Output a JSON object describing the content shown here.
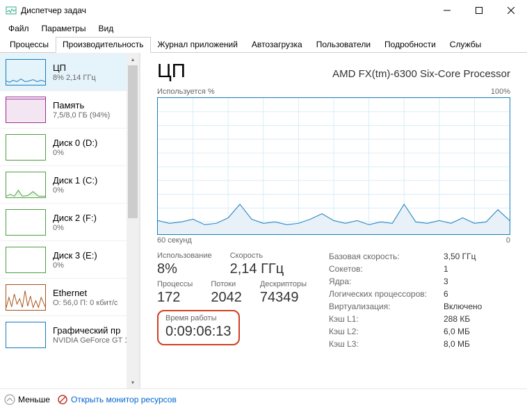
{
  "window": {
    "title": "Диспетчер задач"
  },
  "menu": {
    "file": "Файл",
    "options": "Параметры",
    "view": "Вид"
  },
  "tabs": {
    "processes": "Процессы",
    "performance": "Производительность",
    "app_history": "Журнал приложений",
    "startup": "Автозагрузка",
    "users": "Пользователи",
    "details": "Подробности",
    "services": "Службы"
  },
  "sidebar": {
    "cpu": {
      "title": "ЦП",
      "sub": "8% 2,14 ГГц"
    },
    "memory": {
      "title": "Память",
      "sub": "7,5/8,0 ГБ (94%)"
    },
    "disk0": {
      "title": "Диск 0 (D:)",
      "sub": "0%"
    },
    "disk1": {
      "title": "Диск 1 (C:)",
      "sub": "0%"
    },
    "disk2": {
      "title": "Диск 2 (F:)",
      "sub": "0%"
    },
    "disk3": {
      "title": "Диск 3 (E:)",
      "sub": "0%"
    },
    "ethernet": {
      "title": "Ethernet",
      "sub": "О: 56,0 П: 0 кбит/с"
    },
    "gpu": {
      "title": "Графический пр",
      "sub": "NVIDIA GeForce GT 1"
    }
  },
  "cpu": {
    "title": "ЦП",
    "model": "AMD FX(tm)-6300 Six-Core Processor",
    "util_label": "Используется %",
    "util_max": "100%",
    "time_span": "60 секунд",
    "time_zero": "0",
    "usage_label": "Использование",
    "usage_value": "8%",
    "speed_label": "Скорость",
    "speed_value": "2,14 ГГц",
    "processes_label": "Процессы",
    "processes_value": "172",
    "threads_label": "Потоки",
    "threads_value": "2042",
    "handles_label": "Дескрипторы",
    "handles_value": "74349",
    "uptime_label": "Время работы",
    "uptime_value": "0:09:06:13",
    "base_speed_label": "Базовая скорость:",
    "base_speed_value": "3,50 ГГц",
    "sockets_label": "Сокетов:",
    "sockets_value": "1",
    "cores_label": "Ядра:",
    "cores_value": "3",
    "logical_label": "Логических процессоров:",
    "logical_value": "6",
    "virt_label": "Виртуализация:",
    "virt_value": "Включено",
    "l1_label": "Кэш L1:",
    "l1_value": "288 КБ",
    "l2_label": "Кэш L2:",
    "l2_value": "6,0 МБ",
    "l3_label": "Кэш L3:",
    "l3_value": "8,0 МБ"
  },
  "footer": {
    "less": "Меньше",
    "monitor": "Открыть монитор ресурсов"
  },
  "chart_data": {
    "type": "line",
    "title": "CPU Utilization",
    "xlabel": "Time (seconds)",
    "ylabel": "Utilization %",
    "ylim": [
      0,
      100
    ],
    "x": [
      0,
      2,
      4,
      6,
      8,
      10,
      12,
      14,
      16,
      18,
      20,
      22,
      24,
      26,
      28,
      30,
      32,
      34,
      36,
      38,
      40,
      42,
      44,
      46,
      48,
      50,
      52,
      54,
      56,
      58,
      60
    ],
    "values": [
      10,
      8,
      9,
      11,
      7,
      8,
      12,
      22,
      11,
      8,
      9,
      7,
      8,
      11,
      15,
      10,
      8,
      10,
      7,
      9,
      8,
      22,
      9,
      8,
      10,
      8,
      12,
      8,
      9,
      18,
      10
    ]
  }
}
